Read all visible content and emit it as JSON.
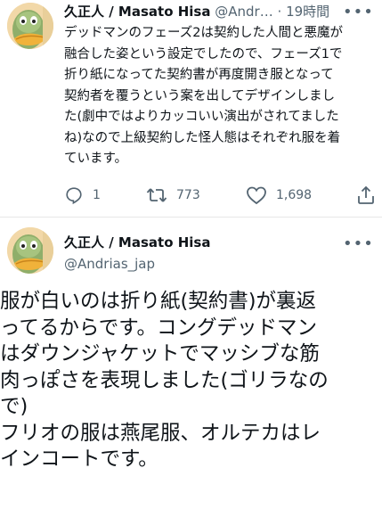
{
  "tweet1": {
    "display_name": "久正人 / Masato Hisa",
    "handle": "@Andr…",
    "separator": "·",
    "time": "19時間",
    "more_label": "•••",
    "text": "デッドマンのフェーズ2は契約した人間と悪魔が\n融合した姿という設定でしたので、フェーズ1で\n折り紙になってた契約書が再度開き服となって\n契約者を覆うという案を出してデザインしまし\nた(劇中ではよりカッコいい演出がされてました\nね)なので上級契約した怪人態はそれぞれ服を着\nています。",
    "actions": {
      "reply_icon": "reply-icon",
      "reply_count": "1",
      "retweet_icon": "retweet-icon",
      "retweet_count": "773",
      "like_icon": "heart-icon",
      "like_count": "1,698",
      "share_icon": "share-icon"
    }
  },
  "tweet2": {
    "display_name": "久正人 / Masato Hisa",
    "handle": "@Andrias_jap",
    "more_label": "•••",
    "text": "服が白いのは折り紙(契約書)が裏返\nってるからです。コングデッドマン\nはダウンジャケットでマッシブな筋\n肉っぽさを表現しました(ゴリラなの\nで)\nフリオの服は燕尾服、オルテカはレ\nインコートです。"
  },
  "colors": {
    "text": "#0f1419",
    "secondary": "#536471",
    "background": "#ffffff"
  }
}
